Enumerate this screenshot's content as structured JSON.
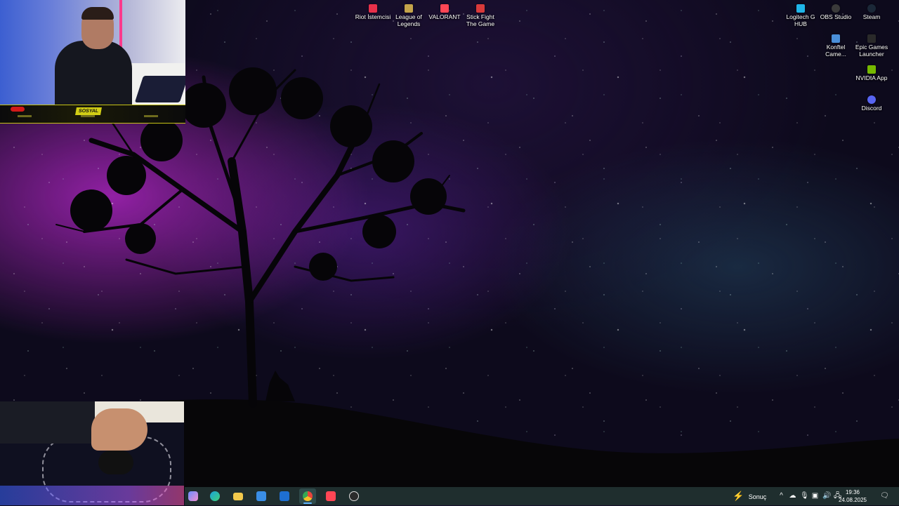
{
  "desktop_icons": [
    {
      "label": "Riot İstemcisi",
      "icon": "riot-client-icon",
      "color": "#e8304a"
    },
    {
      "label": "League of Legends",
      "icon": "league-of-legends-icon",
      "color": "#c4a44b"
    },
    {
      "label": "VALORANT",
      "icon": "valorant-icon",
      "color": "#ff4655"
    },
    {
      "label": "Stick Fight The Game",
      "icon": "stick-fight-icon",
      "color": "#d93a3a"
    },
    {
      "label": "Logitech G HUB",
      "icon": "logitech-g-hub-icon",
      "color": "#1fb5e8"
    },
    {
      "label": "OBS Studio",
      "icon": "obs-studio-icon",
      "color": "#3a3a3a"
    },
    {
      "label": "Steam",
      "icon": "steam-icon",
      "color": "#1b2838"
    },
    {
      "label": "Konftel Came...",
      "icon": "konftel-camera-icon",
      "color": "#4a8fd9"
    },
    {
      "label": "Epic Games Launcher",
      "icon": "epic-games-icon",
      "color": "#2a2a2a"
    },
    {
      "label": "NVIDIA App",
      "icon": "nvidia-icon",
      "color": "#76b900"
    },
    {
      "label": "Discord",
      "icon": "discord-icon",
      "color": "#5865f2"
    }
  ],
  "overlay": {
    "banner_label": "SOSYAL"
  },
  "taskbar": {
    "apps": [
      {
        "name": "copilot",
        "icon": "copilot-icon",
        "color": "#6b8cff"
      },
      {
        "name": "edge",
        "icon": "edge-icon",
        "color": "#1aa3d9"
      },
      {
        "name": "file-explorer",
        "icon": "folder-icon",
        "color": "#f2c94c"
      },
      {
        "name": "microsoft-store",
        "icon": "store-icon",
        "color": "#3a8ee6"
      },
      {
        "name": "outlook",
        "icon": "outlook-icon",
        "color": "#1e6fd1"
      },
      {
        "name": "chrome",
        "icon": "chrome-icon",
        "color": "#e8453c"
      },
      {
        "name": "valorant",
        "icon": "valorant-taskbar-icon",
        "color": "#ff4655"
      },
      {
        "name": "obs",
        "icon": "obs-taskbar-icon",
        "color": "#2b2b2b"
      }
    ],
    "active_app": "chrome",
    "news_label": "Sonuç",
    "clock_time": "19:36",
    "clock_date": "24.08.2025"
  }
}
